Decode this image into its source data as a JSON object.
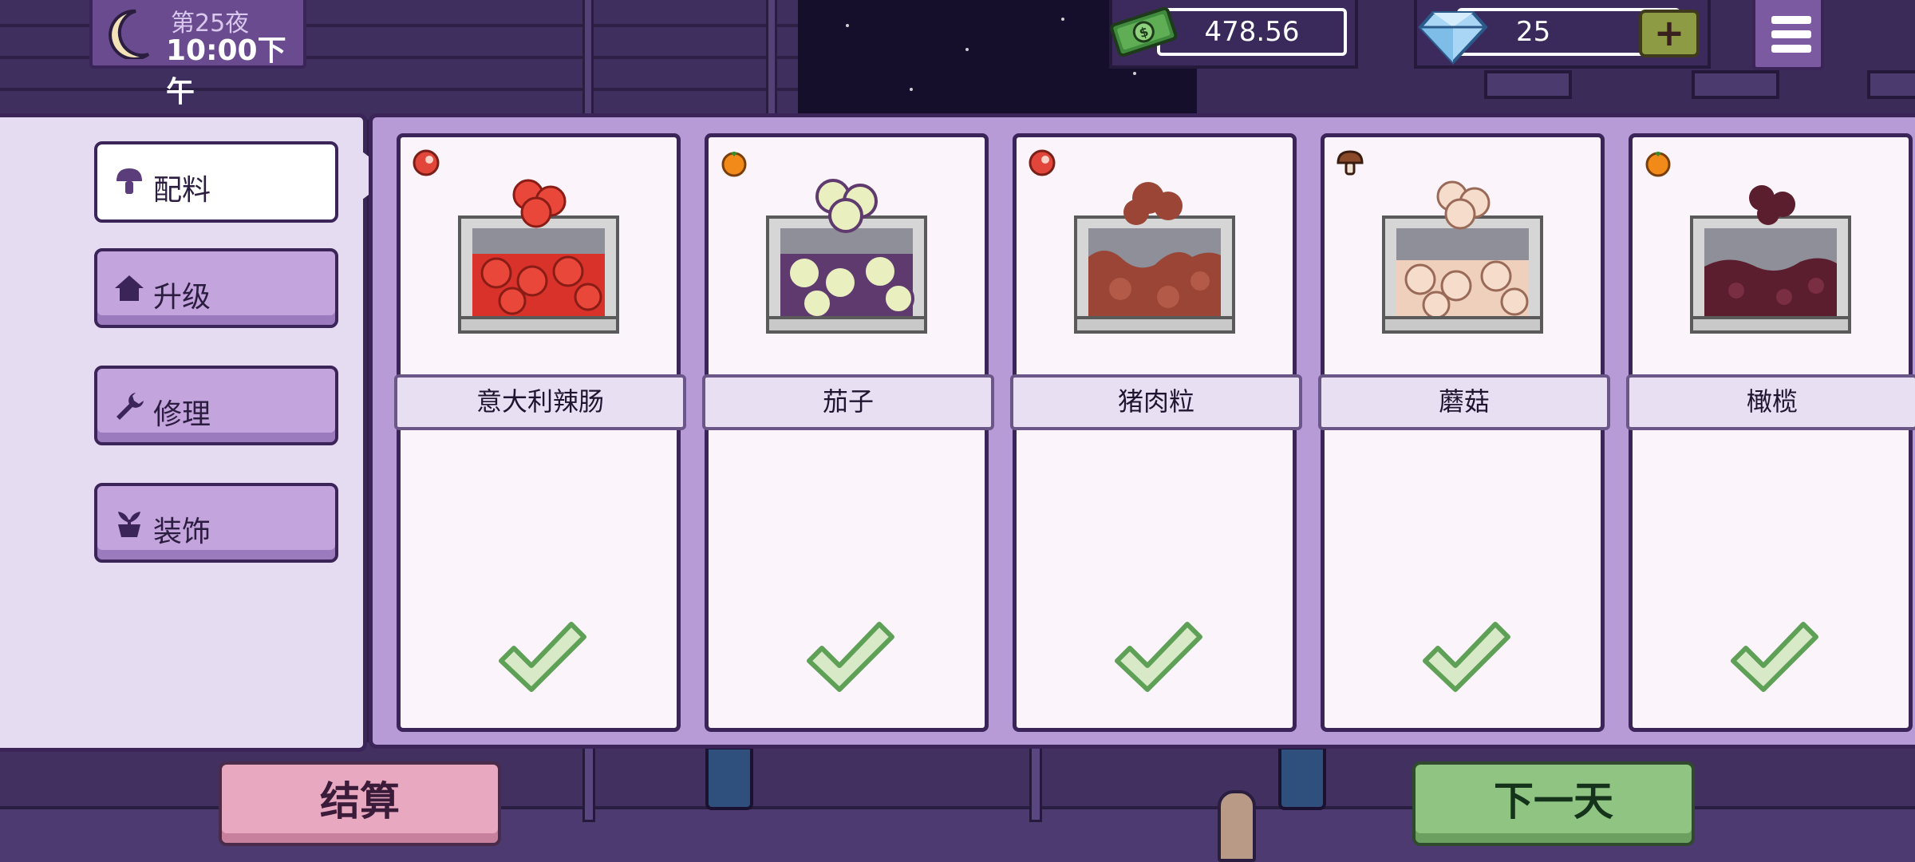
{
  "hud": {
    "night_label": "第25夜",
    "time_label": "10:00下午",
    "money": "478.56",
    "gems": "25",
    "add_gems_label": "+"
  },
  "sidebar": {
    "items": [
      {
        "label": "配料",
        "icon": "mushroom-icon",
        "active": true
      },
      {
        "label": "升级",
        "icon": "house-icon",
        "active": false
      },
      {
        "label": "修理",
        "icon": "wrench-icon",
        "active": false
      },
      {
        "label": "装饰",
        "icon": "potted-plant-icon",
        "active": false
      }
    ]
  },
  "ingredients": [
    {
      "name": "意大利辣肠",
      "tag": "meat-icon",
      "color": "#d8322a",
      "owned": true
    },
    {
      "name": "茄子",
      "tag": "vegetable-icon",
      "color": "#e9efbf",
      "owned": true
    },
    {
      "name": "猪肉粒",
      "tag": "meat-icon",
      "color": "#9a4536",
      "owned": true
    },
    {
      "name": "蘑菇",
      "tag": "mushroom-icon",
      "color": "#f6dccb",
      "owned": true
    },
    {
      "name": "橄榄",
      "tag": "vegetable-icon",
      "color": "#5b1e2e",
      "owned": true
    }
  ],
  "buttons": {
    "settle": "结算",
    "next_day": "下一天"
  },
  "colors": {
    "panel_border": "#3b2458",
    "panel_bg": "#b79bd6",
    "check_green": "#5fa057"
  }
}
